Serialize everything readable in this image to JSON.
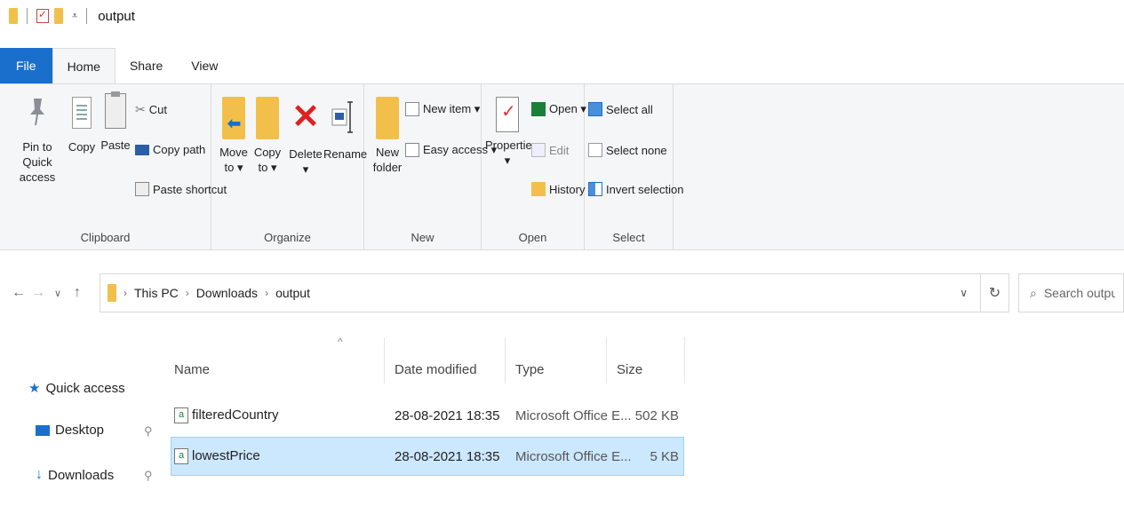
{
  "window": {
    "title": "output"
  },
  "ribbon_tabs": [
    {
      "label": "File"
    },
    {
      "label": "Home"
    },
    {
      "label": "Share"
    },
    {
      "label": "View"
    }
  ],
  "clipboard": {
    "pin_line1": "Pin to Quick",
    "pin_line2": "access",
    "copy": "Copy",
    "paste": "Paste",
    "cut": "Cut",
    "copy_path": "Copy path",
    "paste_shortcut": "Paste shortcut",
    "label": "Clipboard"
  },
  "organize": {
    "move_line1": "Move",
    "move_line2": "to ▾",
    "copy_line1": "Copy",
    "copy_line2": "to ▾",
    "delete": "Delete",
    "delete_dd": "▾",
    "rename": "Rename",
    "label": "Organize"
  },
  "new_group": {
    "new_folder_line1": "New",
    "new_folder_line2": "folder",
    "new_item": "New item ▾",
    "easy_access": "Easy access ▾",
    "label": "New"
  },
  "open_group": {
    "properties": "Properties",
    "properties_dd": "▾",
    "open": "Open ▾",
    "edit": "Edit",
    "history": "History",
    "label": "Open"
  },
  "select_group": {
    "select_all": "Select all",
    "select_none": "Select none",
    "invert_selection": "Invert selection",
    "label": "Select"
  },
  "address": {
    "crumbs": [
      "This PC",
      "Downloads",
      "output"
    ]
  },
  "search": {
    "placeholder": "Search output"
  },
  "nav_pane": {
    "items": [
      {
        "label": "Quick access"
      },
      {
        "label": "Desktop"
      },
      {
        "label": "Downloads"
      }
    ]
  },
  "file_list": {
    "columns": [
      "Name",
      "Date modified",
      "Type",
      "Size"
    ],
    "rows": [
      {
        "name": "filteredCountry",
        "date": "28-08-2021 18:35",
        "type": "Microsoft Office E...",
        "size": "502 KB",
        "selected": false
      },
      {
        "name": "lowestPrice",
        "date": "28-08-2021 18:35",
        "type": "Microsoft Office E...",
        "size": "5 KB",
        "selected": true
      }
    ]
  }
}
